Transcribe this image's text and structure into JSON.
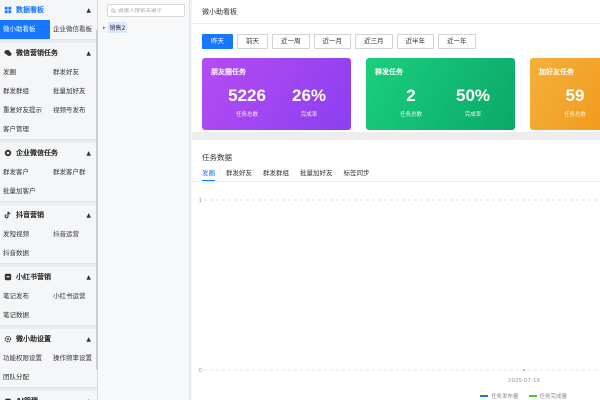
{
  "sidebar": {
    "sections": [
      {
        "title": "数据看板",
        "active": true,
        "icon": "dashboard-icon",
        "items": [
          "微小助看板",
          "企业微信看板"
        ],
        "selected_index": 0
      },
      {
        "title": "微信营销任务",
        "icon": "wechat-icon",
        "items": [
          "发圈",
          "群发好友",
          "群发群组",
          "批量加好友",
          "重复好友提示",
          "视频号发布",
          "客户管理"
        ]
      },
      {
        "title": "企业微信任务",
        "icon": "work-wechat-icon",
        "items": [
          "群发客户",
          "群发客户群",
          "批量加客户"
        ]
      },
      {
        "title": "抖音营销",
        "icon": "douyin-icon",
        "items": [
          "发短视频",
          "抖音运营",
          "抖音数据"
        ]
      },
      {
        "title": "小红书营销",
        "icon": "xiaohongshu-icon",
        "items": [
          "笔记发布",
          "小红书运营",
          "笔记数据"
        ]
      },
      {
        "title": "微小助设置",
        "icon": "settings-icon",
        "items": [
          "功能权限设置",
          "操作频率设置",
          "团队分配"
        ]
      },
      {
        "title": "AI管理",
        "icon": "ai-icon",
        "items": []
      }
    ]
  },
  "tree": {
    "search_placeholder": "请输入搜索关键字",
    "node_label": "销售2"
  },
  "main": {
    "header_title": "微小助看板",
    "date_tabs": [
      "昨天",
      "前天",
      "近一周",
      "近一月",
      "近三月",
      "近半年",
      "近一年"
    ],
    "active_date_tab": 0,
    "cards": [
      {
        "title": "朋友圈任务",
        "stats": [
          {
            "value": "5226",
            "label": "任务总数"
          },
          {
            "value": "26%",
            "label": "完成率"
          }
        ]
      },
      {
        "title": "群发任务",
        "stats": [
          {
            "value": "2",
            "label": "任务总数"
          },
          {
            "value": "50%",
            "label": "完成率"
          }
        ]
      },
      {
        "title": "加好友任务",
        "stats": [
          {
            "value": "59",
            "label": "任务总数"
          }
        ]
      }
    ],
    "section_title": "任务数据",
    "sub_tabs": [
      "发圈",
      "群发好友",
      "群发群组",
      "批量加好友",
      "标签同步"
    ],
    "active_sub_tab": 0
  },
  "chart_data": {
    "type": "line",
    "title": "",
    "x": [
      "2025-07-16"
    ],
    "ylim": [
      0,
      1
    ],
    "yticks": [
      "1",
      "0"
    ],
    "grid": true,
    "legend_position": "bottom-right",
    "series": [
      {
        "name": "任务发布量",
        "color": "#1677ff",
        "values": [
          0
        ]
      },
      {
        "name": "任务完成量",
        "color": "#52c41a",
        "values": [
          0
        ]
      }
    ]
  },
  "colors": {
    "accent": "#1677ff",
    "card_purple": "#9c45f2",
    "card_green": "#12bf74",
    "card_orange": "#f3a62c"
  }
}
